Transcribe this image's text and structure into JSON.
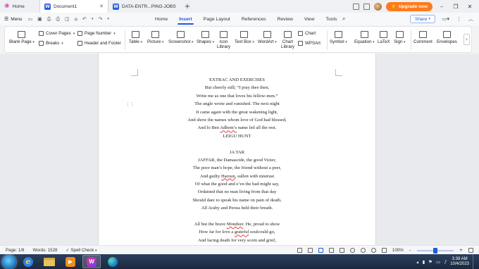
{
  "titlebar": {
    "tabs": [
      {
        "label": "Home"
      },
      {
        "label": "Document1"
      },
      {
        "label": "DATA-ENTR...PING-JOBS"
      }
    ],
    "upgrade_label": "Upgrade now"
  },
  "menubar": {
    "menu_label": "Menu",
    "tabs": [
      "Home",
      "Insert",
      "Page Layout",
      "References",
      "Review",
      "View",
      "Tools"
    ],
    "active_tab": "Insert",
    "share_label": "Share"
  },
  "ribbon": {
    "blank_page": "Blank Page",
    "cover_pages": "Cover Pages",
    "breaks": "Breaks",
    "page_number": "Page Number",
    "header_footer": "Header and Footer",
    "table": "Table",
    "picture": "Picture",
    "screenshot": "Screenshot",
    "shapes": "Shapes",
    "icon_library_1": "Icon",
    "icon_library_2": "Library",
    "text_box": "Text Box",
    "wordart": "WordArt",
    "chart_library_1": "Chart",
    "chart_library_2": "Library",
    "chart": "Chart",
    "wpsart": "WPSArt",
    "symbol": "Symbol",
    "equation": "Equation",
    "latex": "LaTeX",
    "sign": "Sign",
    "comment": "Comment",
    "envelopes": "Envelopes"
  },
  "document": {
    "lines": [
      "EXTRAC AND EXERCISES",
      "But cheerly still; “I pray thee then,",
      "Write me as one that loves his fellow-men.”",
      "The angle wrote and vanished. The next night",
      "It came again with the great wakening light,",
      "And show the names whom love of God had blessed,",
      "And lo Ben Adhem’s name led all the rest.",
      "LEIGU HUNT",
      "",
      "JA TAR",
      "JAFFAR, the Damascide, the good Vizier,",
      "The poor man’s hope, the friend without a peer,",
      "And guilty Haroun, sullen with mistrust",
      "Of what the good and e’en the bad might say,",
      "Ordained that no man living from that day",
      "Should dare to speak his name on pain of death.",
      "All Araby and Persia held their breath.",
      "",
      "All but the brave Mondeer. He, proud to show",
      "How far for love a grateful soulcould go,",
      "And facing death for very scorn and grief,"
    ]
  },
  "statusbar": {
    "page": "Page: 1/8",
    "words": "Words: 1528",
    "spell_check": "Spell Check",
    "zoom": "100%",
    "zoom_level": 0.5
  },
  "taskbar": {
    "time": "3:38 AM",
    "date": "10/4/2023"
  },
  "colors": {
    "accent": "#1f5bd6",
    "upgrade": "#ff7a1a",
    "taskbar": "#1c2a40"
  }
}
